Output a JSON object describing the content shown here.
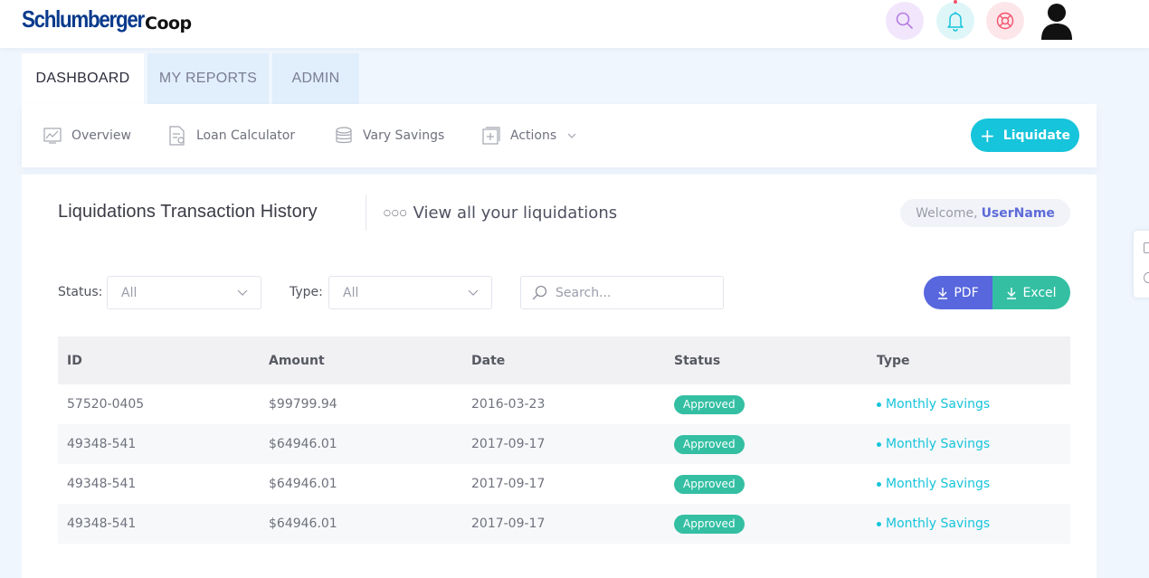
{
  "header": {
    "brand": "Schlumberger",
    "coop": "Coop",
    "icons": [
      "search-icon",
      "bell-icon",
      "lifebuoy-icon",
      "user-avatar-icon"
    ]
  },
  "tabs": [
    {
      "label": "DASHBOARD",
      "active": true
    },
    {
      "label": "MY REPORTS",
      "active": false
    },
    {
      "label": "ADMIN",
      "active": false
    }
  ],
  "subnav": {
    "overview": "Overview",
    "loan_calculator": "Loan Calculator",
    "vary_savings": "Vary Savings",
    "actions": "Actions",
    "liquidate_button": "Liquidate"
  },
  "page": {
    "title": "Liquidations Transaction History",
    "subtitle": "View all your liquidations",
    "welcome_prefix": "Welcome,",
    "username": "UserName"
  },
  "filters": {
    "status_label": "Status:",
    "status_value": "All",
    "type_label": "Type:",
    "type_value": "All",
    "search_placeholder": "Search...",
    "pdf_label": "PDF",
    "excel_label": "Excel"
  },
  "table": {
    "columns": [
      "ID",
      "Amount",
      "Date",
      "Status",
      "Type"
    ],
    "rows": [
      {
        "id": "57520-0405",
        "amount": "$99799.94",
        "date": "2016-03-23",
        "status": "Approved",
        "type": "Monthly Savings"
      },
      {
        "id": "49348-541",
        "amount": "$64946.01",
        "date": "2017-09-17",
        "status": "Approved",
        "type": "Monthly Savings"
      },
      {
        "id": "49348-541",
        "amount": "$64946.01",
        "date": "2017-09-17",
        "status": "Approved",
        "type": "Monthly Savings"
      },
      {
        "id": "49348-541",
        "amount": "$64946.01",
        "date": "2017-09-17",
        "status": "Approved",
        "type": "Monthly Savings"
      }
    ]
  },
  "colors": {
    "accent": "#16c4db",
    "primary": "#5867dd",
    "success": "#34bfa3",
    "brand": "#0a3a8c"
  }
}
